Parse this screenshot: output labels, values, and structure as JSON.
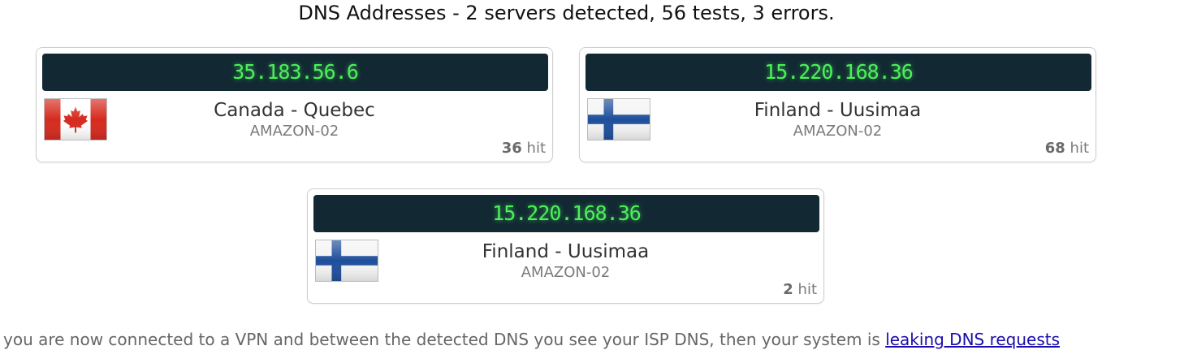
{
  "header": {
    "title": "DNS Addresses - 2 servers detected, 56 tests, 3 errors."
  },
  "servers": [
    {
      "ip": "35.183.56.6",
      "location": "Canada - Quebec",
      "isp": "AMAZON-02",
      "hits": "36",
      "hit_label": "hit",
      "flag": "canada-flag-icon"
    },
    {
      "ip": "15.220.168.36",
      "location": "Finland - Uusimaa",
      "isp": "AMAZON-02",
      "hits": "68",
      "hit_label": "hit",
      "flag": "finland-flag-icon"
    },
    {
      "ip": "15.220.168.36",
      "location": "Finland - Uusimaa",
      "isp": "AMAZON-02",
      "hits": "2",
      "hit_label": "hit",
      "flag": "finland-flag-icon"
    }
  ],
  "footer": {
    "text": "you are now connected to a VPN and between the detected DNS you see your ISP DNS, then your system is",
    "link": "leaking DNS requests"
  },
  "colors": {
    "ip_bar_bg": "#122933",
    "ip_text": "#4cf05a",
    "canada_red": "#d52b1e",
    "finland_blue": "#1f4f9b"
  }
}
